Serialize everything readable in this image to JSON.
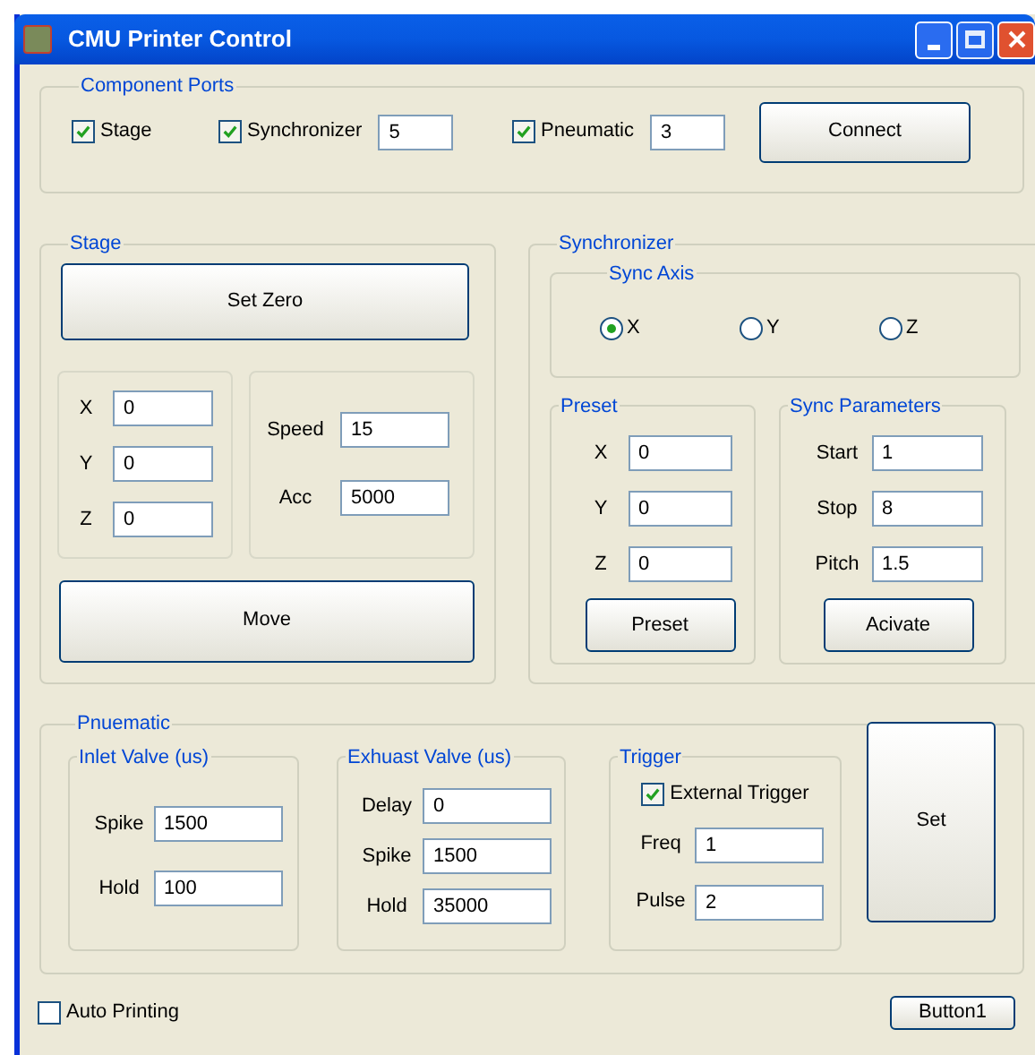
{
  "window": {
    "title": "CMU Printer Control"
  },
  "component_ports": {
    "title": "Component Ports",
    "items": [
      {
        "label": "Stage",
        "checked": true
      },
      {
        "label": "Synchronizer",
        "checked": true,
        "value": "5"
      },
      {
        "label": "Pneumatic",
        "checked": true,
        "value": "3"
      }
    ],
    "button": "Connect"
  },
  "stage": {
    "title": "Stage",
    "set_zero_button": "Set Zero",
    "position_fields": [
      {
        "label": "X",
        "value": "0"
      },
      {
        "label": "Y",
        "value": "0"
      },
      {
        "label": "Z",
        "value": "0"
      }
    ],
    "motion_fields": [
      {
        "label": "Speed",
        "value": "15"
      },
      {
        "label": "Acc",
        "value": "5000"
      }
    ],
    "move_button": "Move"
  },
  "synchronizer": {
    "title": "Synchronizer",
    "sync_axis": {
      "title": "Sync Axis",
      "options": [
        {
          "label": "X",
          "selected": true
        },
        {
          "label": "Y",
          "selected": false
        },
        {
          "label": "Z",
          "selected": false
        }
      ]
    },
    "preset": {
      "title": "Preset",
      "fields": [
        {
          "label": "X",
          "value": "0"
        },
        {
          "label": "Y",
          "value": "0"
        },
        {
          "label": "Z",
          "value": "0"
        }
      ],
      "button": "Preset"
    },
    "sync_parameters": {
      "title": "Sync Parameters",
      "fields": [
        {
          "label": "Start",
          "value": "1"
        },
        {
          "label": "Stop",
          "value": "8"
        },
        {
          "label": "Pitch",
          "value": "1.5"
        }
      ],
      "button": "Acivate"
    }
  },
  "pneumatic": {
    "title": "Pnuematic",
    "inlet_valve": {
      "title": "Inlet Valve (us)",
      "fields": [
        {
          "label": "Spike",
          "value": "1500"
        },
        {
          "label": "Hold",
          "value": "100"
        }
      ]
    },
    "exhaust_valve": {
      "title": "Exhuast Valve (us)",
      "fields": [
        {
          "label": "Delay",
          "value": "0"
        },
        {
          "label": "Spike",
          "value": "1500"
        },
        {
          "label": "Hold",
          "value": "35000"
        }
      ]
    },
    "trigger": {
      "title": "Trigger",
      "external_trigger": {
        "label": "External Trigger",
        "checked": true
      },
      "fields": [
        {
          "label": "Freq",
          "value": "1"
        },
        {
          "label": "Pulse",
          "value": "2"
        }
      ]
    },
    "set_button": "Set"
  },
  "auto_printing": {
    "label": "Auto Printing",
    "checked": false
  },
  "button1": "Button1"
}
